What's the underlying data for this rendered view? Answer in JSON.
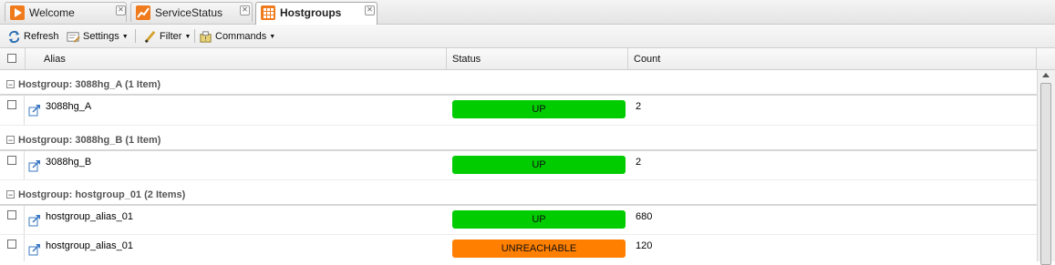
{
  "tabs": [
    {
      "label": "Welcome",
      "icon": "play-icon",
      "icon_color": "#f07b1d",
      "active": false
    },
    {
      "label": "ServiceStatus",
      "icon": "chart-icon",
      "icon_color": "#f07b1d",
      "active": false
    },
    {
      "label": "Hostgroups",
      "icon": "grid-icon",
      "icon_color": "#f07b1d",
      "active": true
    }
  ],
  "toolbar": {
    "refresh_label": "Refresh",
    "settings_label": "Settings",
    "filter_label": "Filter",
    "commands_label": "Commands"
  },
  "columns": {
    "alias": "Alias",
    "status": "Status",
    "count": "Count"
  },
  "groups": [
    {
      "title": "Hostgroup: 3088hg_A (1 Item)",
      "rows": [
        {
          "alias": "3088hg_A",
          "status": "UP",
          "status_color": "#00cc00",
          "count": "2"
        }
      ]
    },
    {
      "title": "Hostgroup: 3088hg_B (1 Item)",
      "rows": [
        {
          "alias": "3088hg_B",
          "status": "UP",
          "status_color": "#00cc00",
          "count": "2"
        }
      ]
    },
    {
      "title": "Hostgroup: hostgroup_01 (2 Items)",
      "rows": [
        {
          "alias": "hostgroup_alias_01",
          "status": "UP",
          "status_color": "#00cc00",
          "count": "680"
        },
        {
          "alias": "hostgroup_alias_01",
          "status": "UNREACHABLE",
          "status_color": "#ff7f00",
          "count": "120"
        }
      ]
    }
  ]
}
